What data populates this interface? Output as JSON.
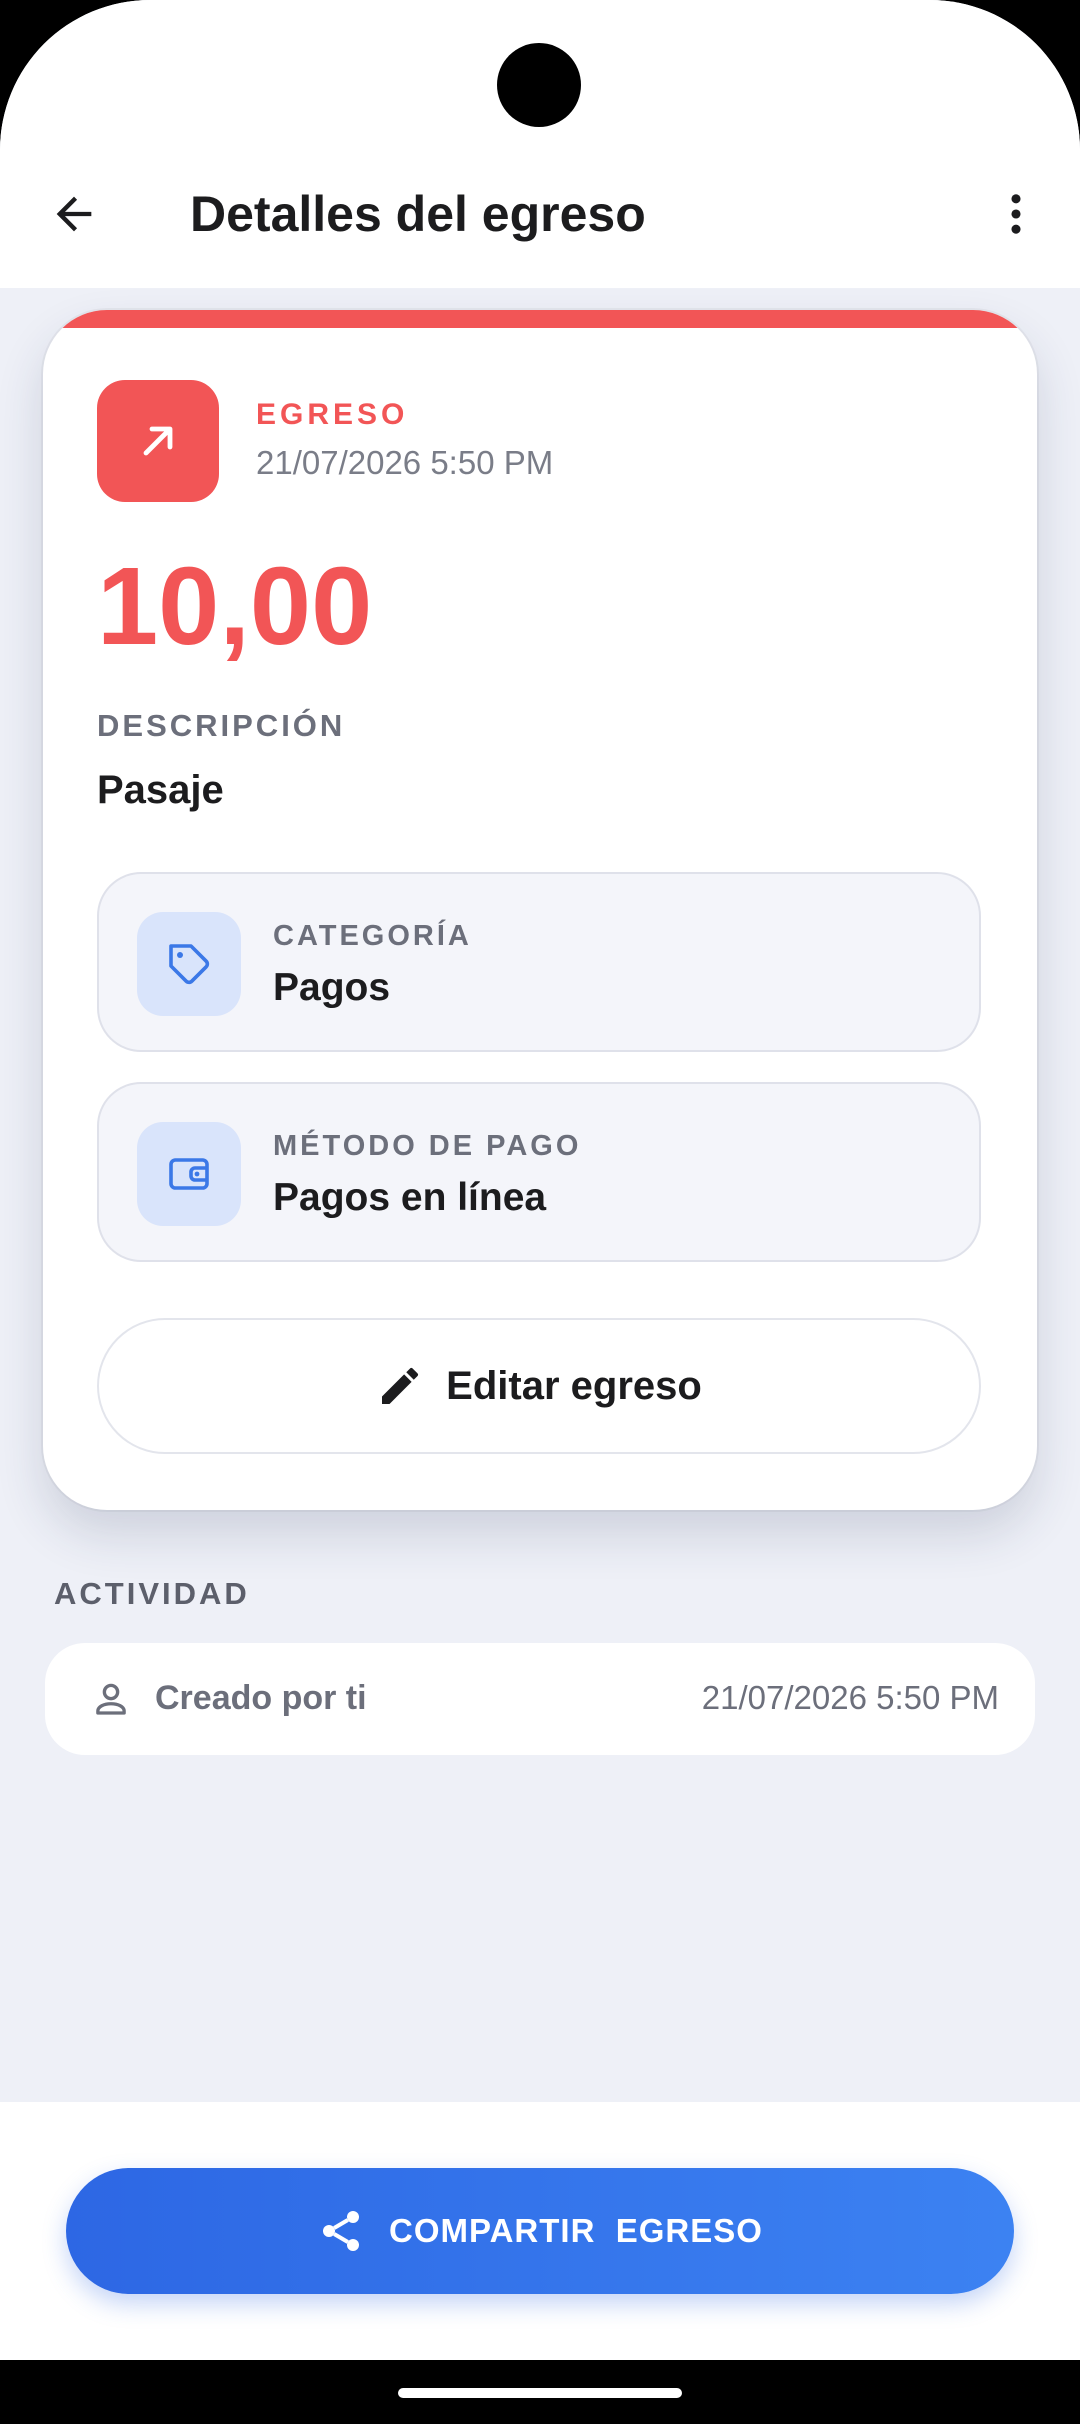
{
  "header": {
    "title": "Detalles del egreso"
  },
  "transaction": {
    "type_label": "EGRESO",
    "datetime": "21/07/2026 5:50 PM",
    "amount": "10,00",
    "description_label": "DESCRIPCIÓN",
    "description": "Pasaje",
    "category_label": "CATEGORÍA",
    "category": "Pagos",
    "payment_method_label": "MÉTODO DE PAGO",
    "payment_method": "Pagos en línea",
    "edit_label": "Editar egreso"
  },
  "activity": {
    "title": "ACTIVIDAD",
    "items": [
      {
        "text": "Creado por ti",
        "time": "21/07/2026 5:50 PM"
      }
    ]
  },
  "footer": {
    "share_label": "COMPARTIR  EGRESO"
  },
  "colors": {
    "expense_red": "#f25556",
    "primary_blue": "#2d67e4",
    "icon_bg_blue": "#d9e4fb",
    "background": "#eef0f7"
  },
  "icons": {
    "back": "arrow-left-icon",
    "more": "more-vertical-icon",
    "type": "arrow-up-right-icon",
    "category": "tag-icon",
    "payment": "wallet-icon",
    "edit": "pencil-icon",
    "activity_user": "person-icon",
    "share": "share-icon"
  }
}
